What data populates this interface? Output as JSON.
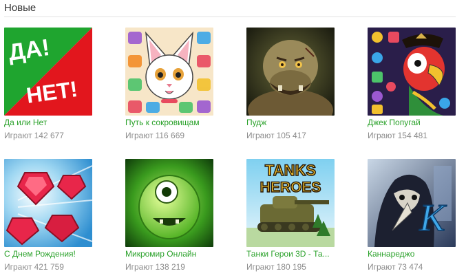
{
  "section": {
    "title": "Новые"
  },
  "games": [
    {
      "title": "Да или Нет",
      "plays_label": "Играют",
      "plays": "142 677",
      "art_text": [
        "ДА!",
        "НЕТ!"
      ]
    },
    {
      "title": "Путь к сокровищам",
      "plays_label": "Играют",
      "plays": "116 669"
    },
    {
      "title": "Пудж",
      "plays_label": "Играют",
      "plays": "105 417"
    },
    {
      "title": "Джек Попугай",
      "plays_label": "Играют",
      "plays": "154 481"
    },
    {
      "title": "С Днем Рождения!",
      "plays_label": "Играют",
      "plays": "421 759"
    },
    {
      "title": "Микромир Онлайн",
      "plays_label": "Играют",
      "plays": "138 219"
    },
    {
      "title": "Танки Герои 3D - Та...",
      "plays_label": "Играют",
      "plays": "180 195",
      "art_text": [
        "TANKS",
        "HEROES"
      ]
    },
    {
      "title": "Каннареджо",
      "plays_label": "Играют",
      "plays": "73 474",
      "art_text": [
        "K"
      ]
    }
  ],
  "colors": {
    "title_link": "#2aa12a",
    "muted": "#8c8c8c",
    "divider": "#e3e3e3"
  }
}
